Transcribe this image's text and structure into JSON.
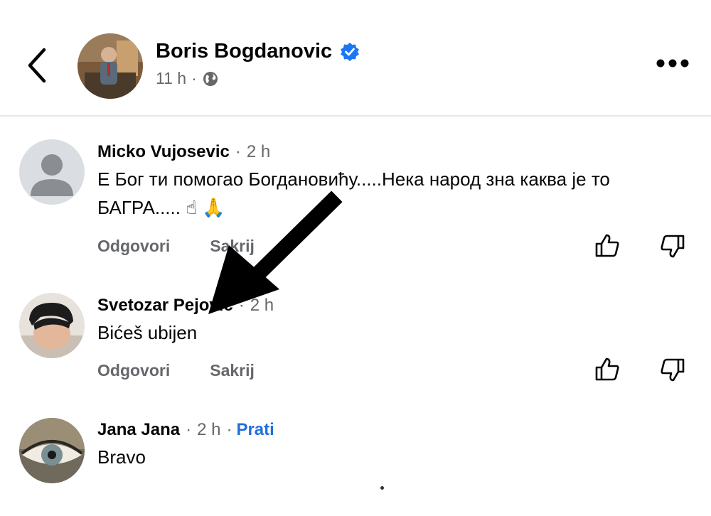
{
  "post": {
    "author": "Boris Bogdanovic",
    "time": "11 h",
    "separator": "·"
  },
  "comments": [
    {
      "name": "Micko Vujosevic",
      "time": "2 h",
      "text": "Е Бог ти помогао Богдановићу.....Нека народ зна каква је то БАГРА..... ☝ 🙏",
      "reply": "Odgovori",
      "hide": "Sakrij"
    },
    {
      "name": "Svetozar Pejovic",
      "time": "2 h",
      "text": "Bićeš ubijen",
      "reply": "Odgovori",
      "hide": "Sakrij"
    },
    {
      "name": "Jana Jana",
      "time": "2 h",
      "follow": "Prati",
      "text": "Bravo"
    }
  ],
  "colors": {
    "verified": "#1d77f2",
    "follow_link": "#216fdb",
    "secondary_text": "#65676b",
    "arrow": "#000000"
  },
  "icons": [
    "back-chevron-icon",
    "verified-badge-icon",
    "globe-icon",
    "more-options-icon",
    "thumbs-up-icon",
    "thumbs-down-icon",
    "arrow-annotation"
  ]
}
